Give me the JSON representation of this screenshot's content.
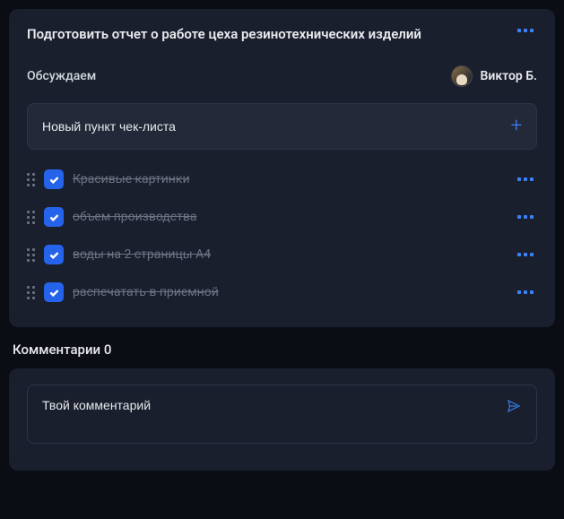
{
  "task": {
    "title": "Подготовить отчет о работе цеха резинотехнических изделий",
    "status": "Обсуждаем",
    "assignee": "Виктор Б."
  },
  "newItem": {
    "placeholder": "Новый пункт чек-листа"
  },
  "checklist": [
    {
      "text": "Красивые картинки",
      "done": true
    },
    {
      "text": "объем производства",
      "done": true
    },
    {
      "text": "воды на 2 страницы А4",
      "done": true
    },
    {
      "text": "распечатать в приемной",
      "done": true
    }
  ],
  "comments": {
    "header": "Комментарии 0",
    "placeholder": "Твой комментарий"
  }
}
